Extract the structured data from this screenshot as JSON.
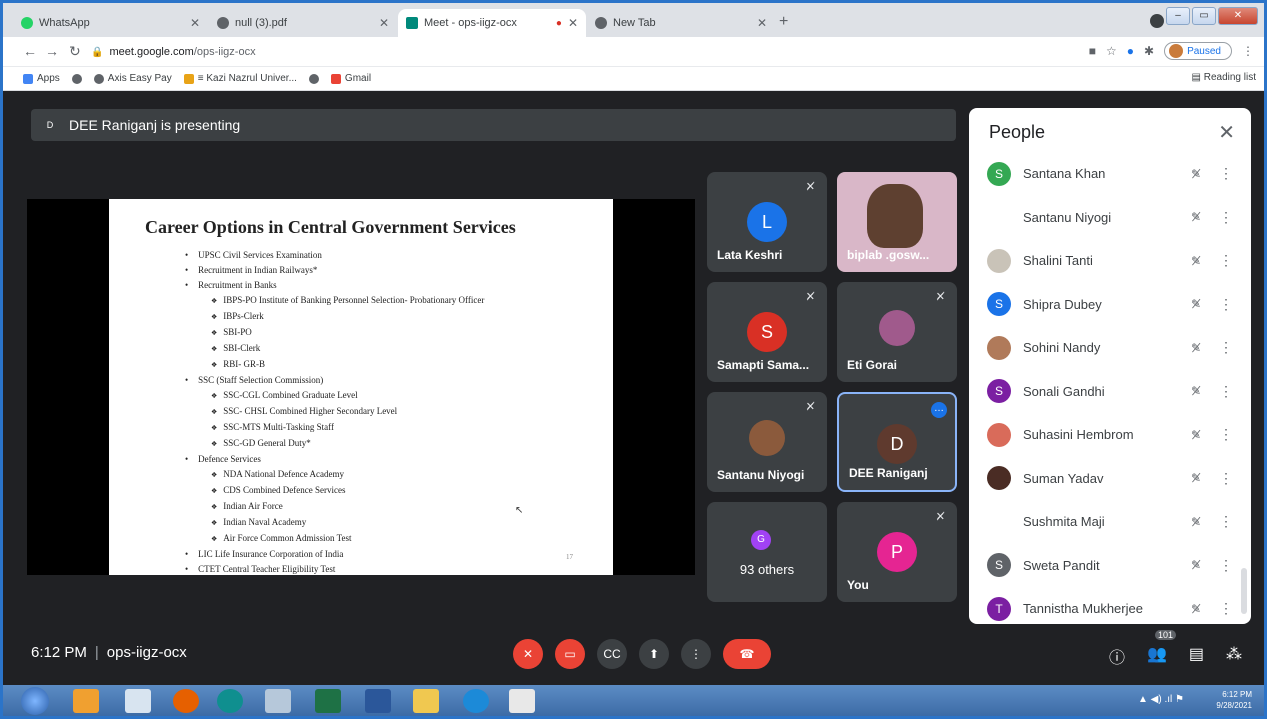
{
  "browser": {
    "tabs": [
      {
        "title": "WhatsApp",
        "favicon_color": "#25d366",
        "active": false
      },
      {
        "title": "null (3).pdf",
        "favicon_color": "#5f6368",
        "active": false
      },
      {
        "title": "Meet - ops-iigz-ocx",
        "favicon_color": "#00897b",
        "active": true
      },
      {
        "title": "New Tab",
        "favicon_color": "#5f6368",
        "active": false
      }
    ],
    "new_tab_label": "+",
    "url_host": "meet.google.com",
    "url_path": "/ops-iigz-ocx",
    "profile_label": "Paused",
    "reading_list": "Reading list",
    "bookmarks": [
      {
        "label": "Apps",
        "icon": "apps-grid-icon",
        "color": "#4285f4"
      },
      {
        "label": "",
        "icon": "globe-icon",
        "color": "#5f6368"
      },
      {
        "label": "Axis Easy Pay",
        "icon": "globe-icon",
        "color": "#5f6368"
      },
      {
        "label": "≡ Kazi Nazrul Univer...",
        "icon": "university-icon",
        "color": "#e8a317"
      },
      {
        "label": "",
        "icon": "globe-icon",
        "color": "#5f6368"
      },
      {
        "label": "Gmail",
        "icon": "gmail-icon",
        "color": "#ea4335"
      }
    ]
  },
  "meet": {
    "presenter_initial": "D",
    "presenter_banner": "DEE Raniganj is presenting",
    "meeting_time": "6:12 PM",
    "meeting_code": "ops-iigz-ocx",
    "participant_count": "101",
    "slide": {
      "title": "Career Options in Central Government Services",
      "page_number": "17",
      "items": [
        {
          "level": 1,
          "text": "UPSC Civil Services Examination"
        },
        {
          "level": 1,
          "text": "Recruitment in Indian Railways*"
        },
        {
          "level": 1,
          "text": "Recruitment in Banks"
        },
        {
          "level": 2,
          "text": "IBPS-PO Institute of Banking Personnel Selection- Probationary Officer"
        },
        {
          "level": 2,
          "text": "IBPs-Clerk"
        },
        {
          "level": 2,
          "text": "SBI-PO"
        },
        {
          "level": 2,
          "text": "SBI-Clerk"
        },
        {
          "level": 2,
          "text": "RBI- GR-B"
        },
        {
          "level": 1,
          "text": "SSC (Staff Selection Commission)"
        },
        {
          "level": 2,
          "text": "SSC-CGL Combined Graduate Level"
        },
        {
          "level": 2,
          "text": "SSC- CHSL Combined Higher Secondary Level"
        },
        {
          "level": 2,
          "text": "SSC-MTS Multi-Tasking Staff"
        },
        {
          "level": 2,
          "text": "SSC-GD General Duty*"
        },
        {
          "level": 1,
          "text": "Defence Services"
        },
        {
          "level": 2,
          "text": "NDA National Defence Academy"
        },
        {
          "level": 2,
          "text": "CDS Combined Defence Services"
        },
        {
          "level": 2,
          "text": "Indian Air Force"
        },
        {
          "level": 2,
          "text": "Indian Naval Academy"
        },
        {
          "level": 2,
          "text": "Air Force Common Admission Test"
        },
        {
          "level": 1,
          "text": "LIC Life Insurance Corporation of India"
        },
        {
          "level": 1,
          "text": "CTET Central Teacher Eligibility Test"
        }
      ]
    },
    "tiles": [
      {
        "name": "Lata Keshri",
        "initial": "L",
        "color": "#1a73e8",
        "type": "initial",
        "muted": true
      },
      {
        "name": "biplab .gosw...",
        "initial": "",
        "color": "",
        "type": "video",
        "muted": false
      },
      {
        "name": "Samapti Sama...",
        "initial": "S",
        "color": "#d93025",
        "type": "initial",
        "muted": true
      },
      {
        "name": "Eti Gorai",
        "initial": "",
        "color": "#a05a8c",
        "type": "photo",
        "muted": true
      },
      {
        "name": "Santanu Niyogi",
        "initial": "",
        "color": "#8b5a3c",
        "type": "photo",
        "muted": true
      },
      {
        "name": "DEE Raniganj",
        "initial": "D",
        "color": "#5f3a2e",
        "type": "initial",
        "muted": false
      },
      {
        "name": "93 others",
        "initial": "G",
        "color": "#a142f4",
        "type": "others",
        "muted": false
      },
      {
        "name": "You",
        "initial": "P",
        "color": "#e52592",
        "type": "initial",
        "muted": true
      }
    ],
    "people_panel": {
      "title": "People",
      "people": [
        {
          "name": "Santana Khan",
          "initial": "S",
          "color": "#34a853"
        },
        {
          "name": "Santanu Niyogi",
          "initial": "",
          "color": "#ffffff"
        },
        {
          "name": "Shalini Tanti",
          "initial": "",
          "color": "#c9c3b8"
        },
        {
          "name": "Shipra Dubey",
          "initial": "S",
          "color": "#1a73e8"
        },
        {
          "name": "Sohini Nandy",
          "initial": "",
          "color": "#b07a5a"
        },
        {
          "name": "Sonali Gandhi",
          "initial": "S",
          "color": "#7b1fa2"
        },
        {
          "name": "Suhasini Hembrom",
          "initial": "",
          "color": "#d96b5a"
        },
        {
          "name": "Suman Yadav",
          "initial": "",
          "color": "#4a2c24"
        },
        {
          "name": "Sushmita Maji",
          "initial": "",
          "color": "#ffffff"
        },
        {
          "name": "Sweta Pandit",
          "initial": "S",
          "color": "#5f6368"
        },
        {
          "name": "Tannistha Mukherjee",
          "initial": "T",
          "color": "#7b1fa2"
        }
      ]
    }
  },
  "taskbar": {
    "time": "6:12 PM",
    "date": "9/28/2021"
  }
}
